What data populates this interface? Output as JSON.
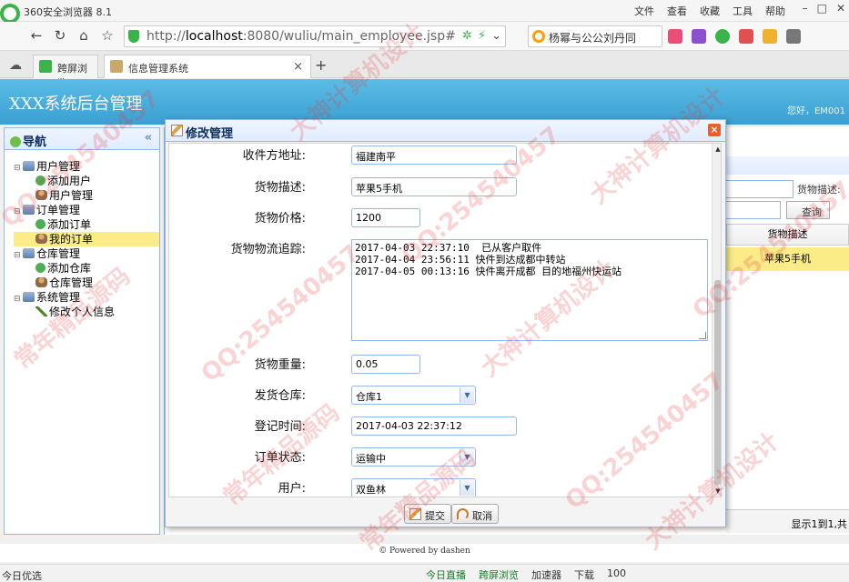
{
  "browser": {
    "app_title": "360安全浏览器 8.1",
    "menus": [
      "文件",
      "查看",
      "收藏",
      "工具",
      "帮助"
    ],
    "url_host": "localhost",
    "url_rest": ":8080/wuliu/main_employee.jsp#",
    "url_prefix": "http://",
    "search_text": "杨幂与公公刘丹同",
    "tabs": [
      {
        "label": "跨屏浏览"
      },
      {
        "label": "信息管理系统"
      }
    ],
    "status_left": "今日优选",
    "status_right": [
      "今日直播",
      "跨屏浏览",
      "加速器",
      "下载",
      "100"
    ]
  },
  "app": {
    "system_name": "XXX系统后台管理",
    "greeting": "您好，EM001",
    "footer": "© Powered by dashen",
    "nav": {
      "title": "导航",
      "collapse_glyph": "«",
      "groups": [
        {
          "label": "用户管理",
          "children": [
            "添加用户",
            "用户管理"
          ]
        },
        {
          "label": "订单管理",
          "children": [
            "添加订单",
            "我的订单"
          ]
        },
        {
          "label": "仓库管理",
          "children": [
            "添加仓库",
            "仓库管理"
          ]
        },
        {
          "label": "系统管理",
          "children": [
            "修改个人信息"
          ]
        }
      ],
      "selected": "我的订单"
    },
    "background": {
      "field_label": "货物描述:",
      "query_label": "查询",
      "column_header": "货物描述",
      "row_value": "苹果5手机",
      "pager_text": "显示1到1,共"
    }
  },
  "dialog": {
    "title": "修改管理",
    "fields": {
      "address_label": "收件方地址:",
      "address_value": "福建南平",
      "desc_label": "货物描述:",
      "desc_value": "苹果5手机",
      "price_label": "货物价格:",
      "price_value": "1200",
      "track_label": "货物物流追踪:",
      "track_value": "2017-04-03 22:37:10  已从客户取件\n2017-04-04 23:56:11 快件到达成都中转站\n2017-04-05 00:13:16 快件离开成都 目的地福州快运站",
      "weight_label": "货物重量:",
      "weight_value": "0.05",
      "warehouse_label": "发货仓库:",
      "warehouse_value": "仓库1",
      "time_label": "登记时间:",
      "time_value": "2017-04-03 22:37:12",
      "status_label": "订单状态:",
      "status_value": "运输中",
      "user_label": "用户:",
      "user_value": "双鱼林"
    },
    "submit_label": "提交",
    "cancel_label": "取消"
  },
  "watermarks": [
    "QQ:254540457",
    "大神计算机设计",
    "常年精品源码",
    "QQ:254540457",
    "常年精品源码",
    "大神计算机设计",
    "QQ:254540457",
    "QQ:254540457",
    "大神计算机设计",
    "常年精品源码",
    "QQ:254540457",
    "大神计算机设计"
  ]
}
